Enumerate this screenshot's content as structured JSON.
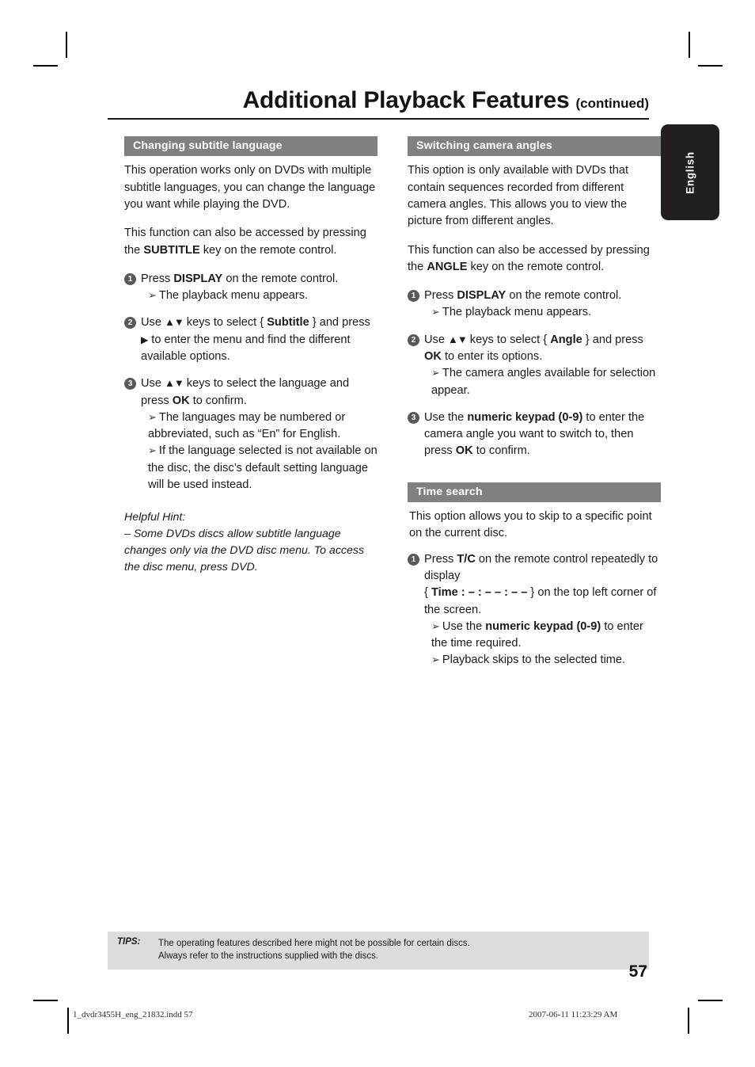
{
  "header": {
    "title": "Additional Playback Features",
    "continued": "(continued)"
  },
  "side_tab": {
    "label": "English"
  },
  "left_column": {
    "section1": {
      "heading": "Changing subtitle language",
      "paragraph1": "This operation works only on DVDs with multiple subtitle languages, you can change the language you want while playing the DVD.",
      "paragraph2_pre": "This function can also be accessed by pressing the ",
      "paragraph2_key": "SUBTITLE",
      "paragraph2_post": " key on the remote control.",
      "steps": [
        {
          "number": "1",
          "text_pre": "Press ",
          "text_key": "DISPLAY",
          "text_post": " on the remote control.",
          "results": [
            "The playback menu appears."
          ]
        },
        {
          "number": "2",
          "text_pre": "Use ",
          "text_keys": "▲▼",
          "text_mid": " keys to select { ",
          "text_option": "Subtitle",
          "text_mid2": " } and press ",
          "text_arrow": "▶",
          "text_post": " to enter the menu and find the different available options.",
          "results": []
        },
        {
          "number": "3",
          "text_pre": "Use ",
          "text_keys": "▲▼",
          "text_mid": " keys to select the language and press ",
          "text_option": "OK",
          "text_post": " to confirm.",
          "results": [
            "The languages may be numbered or abbreviated, such as “En” for English.",
            "If the language selected is not available on the disc, the disc’s default setting language will be used instead."
          ]
        }
      ],
      "hint_title": "Helpful Hint:",
      "hint_text": "– Some DVDs discs allow subtitle language changes only via the DVD disc menu. To access the disc menu, press DVD."
    }
  },
  "right_column": {
    "section1": {
      "heading": "Switching camera angles",
      "paragraph1": "This option is only available with DVDs that contain sequences recorded from different camera angles. This allows you to view the picture from different angles.",
      "paragraph2_pre": "This function can also be accessed by pressing the ",
      "paragraph2_key": "ANGLE",
      "paragraph2_post": " key on the remote control.",
      "steps": [
        {
          "number": "1",
          "text_pre": "Press ",
          "text_key": "DISPLAY",
          "text_post": " on the remote control.",
          "results": [
            "The playback menu appears."
          ]
        },
        {
          "number": "2",
          "text_pre": "Use ",
          "text_keys": "▲▼",
          "text_mid": " keys to select { ",
          "text_option": "Angle",
          "text_mid2": " } and press ",
          "text_option2": "OK",
          "text_post": " to enter its options.",
          "results": [
            "The camera angles available for selection appear."
          ]
        },
        {
          "number": "3",
          "text_pre": "Use the ",
          "text_key": "numeric keypad (0-9)",
          "text_mid": " to enter the camera angle you want to switch to, then press ",
          "text_option": "OK",
          "text_post": " to confirm.",
          "results": []
        }
      ]
    },
    "section2": {
      "heading": "Time search",
      "paragraph1": "This option allows you to skip to a specific point on the current disc.",
      "steps": [
        {
          "number": "1",
          "text_pre": "Press ",
          "text_key": "T/C",
          "text_post": " on the remote control repeatedly to display",
          "time_open": "{ ",
          "time_label": "Time :  – : – – : – –",
          "time_close": " }",
          "time_tail": " on the top left corner of the screen.",
          "results": [
            {
              "pre": "Use the ",
              "key": "numeric keypad (0-9)",
              "post": " to enter the time required."
            },
            {
              "pre": "Playback skips to the selected time.",
              "key": "",
              "post": ""
            }
          ]
        }
      ]
    }
  },
  "tips": {
    "label": "TIPS:",
    "line1": "The operating features described here might not be possible for certain discs.",
    "line2": "Always refer to the instructions supplied with the discs."
  },
  "page_number": "57",
  "footer": {
    "left": "1_dvdr3455H_eng_21832.indd   57",
    "right": "2007-06-11   11:23:29 AM"
  }
}
